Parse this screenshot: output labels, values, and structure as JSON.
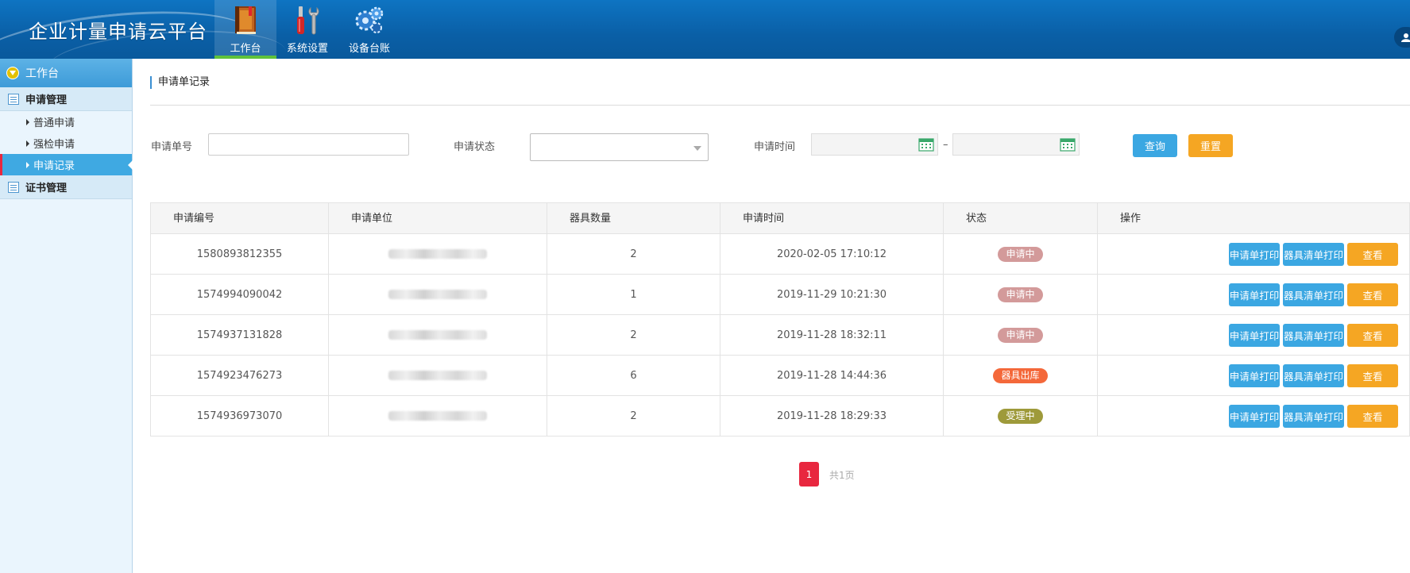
{
  "header": {
    "app_title": "企业计量申请云平台",
    "nav": [
      {
        "label": "工作台",
        "icon": "book-icon",
        "active": true
      },
      {
        "label": "系统设置",
        "icon": "tools-icon",
        "active": false
      },
      {
        "label": "设备台账",
        "icon": "gears-icon",
        "active": false
      }
    ],
    "user_icon": "user-icon"
  },
  "sidebar": {
    "root": "工作台",
    "groups": [
      {
        "label": "申请管理",
        "items": [
          {
            "label": "普通申请"
          },
          {
            "label": "强检申请"
          },
          {
            "label": "申请记录",
            "active": true
          }
        ]
      },
      {
        "label": "证书管理",
        "items": []
      }
    ]
  },
  "main": {
    "title": "申请单记录",
    "filters": {
      "number_label": "申请单号",
      "number_value": "",
      "status_label": "申请状态",
      "status_value": "",
      "time_label": "申请时间",
      "time_from": "",
      "time_to": "",
      "dash": "–",
      "query_button": "查询",
      "reset_button": "重置"
    },
    "table": {
      "headers": [
        "申请编号",
        "申请单位",
        "器具数量",
        "申请时间",
        "状态",
        "操作"
      ],
      "rows": [
        {
          "id": "1580893812355",
          "qty": "2",
          "time": "2020-02-05 17:10:12",
          "status": "申请中",
          "status_color": "#d39a9a"
        },
        {
          "id": "1574994090042",
          "qty": "1",
          "time": "2019-11-29 10:21:30",
          "status": "申请中",
          "status_color": "#d39a9a"
        },
        {
          "id": "1574937131828",
          "qty": "2",
          "time": "2019-11-28 18:32:11",
          "status": "申请中",
          "status_color": "#d39a9a"
        },
        {
          "id": "1574923476273",
          "qty": "6",
          "time": "2019-11-28 14:44:36",
          "status": "器具出库",
          "status_color": "#f4683a"
        },
        {
          "id": "1574936973070",
          "qty": "2",
          "time": "2019-11-28 18:29:33",
          "status": "受理中",
          "status_color": "#9e9a3a"
        }
      ],
      "actions": {
        "print_form": "申请单打印",
        "print_list": "器具清单打印",
        "view": "查看"
      }
    },
    "pagination": {
      "current": "1",
      "total": "共1页"
    }
  },
  "colors": {
    "header_bg": "#0a63a8",
    "accent_blue": "#3ba7e2",
    "accent_orange": "#f5a623",
    "active_red": "#e8273f",
    "nav_active_green": "#5fc23b"
  }
}
